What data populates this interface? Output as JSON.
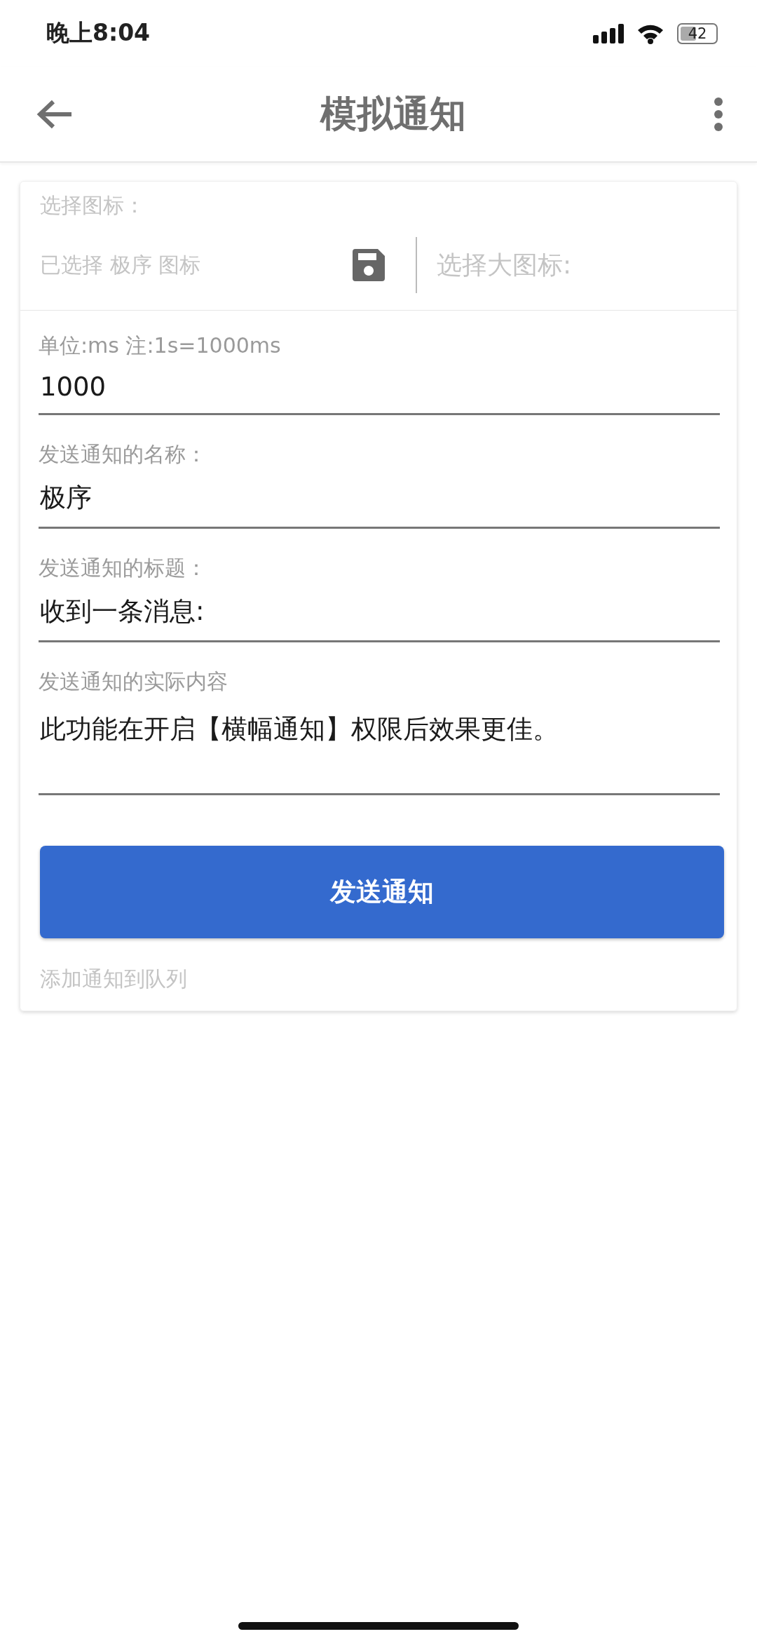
{
  "status_bar": {
    "time": "晚上8:04",
    "battery": "42"
  },
  "app_bar": {
    "title": "模拟通知"
  },
  "icon_picker": {
    "label": "选择图标：",
    "selected_text": "已选择 极序 图标",
    "large_icon_label": "选择大图标:"
  },
  "fields": [
    {
      "kind": "input",
      "label": "单位:ms 注:1s=1000ms",
      "value": "1000"
    },
    {
      "kind": "input",
      "label": "发送通知的名称：",
      "value": "极序"
    },
    {
      "kind": "input",
      "label": "发送通知的标题：",
      "value": "收到一条消息:"
    },
    {
      "kind": "textarea",
      "label": "发送通知的实际内容",
      "value": "此功能在开启【横幅通知】权限后效果更佳。"
    }
  ],
  "send_button": "发送通知",
  "queue_link": "添加通知到队列"
}
